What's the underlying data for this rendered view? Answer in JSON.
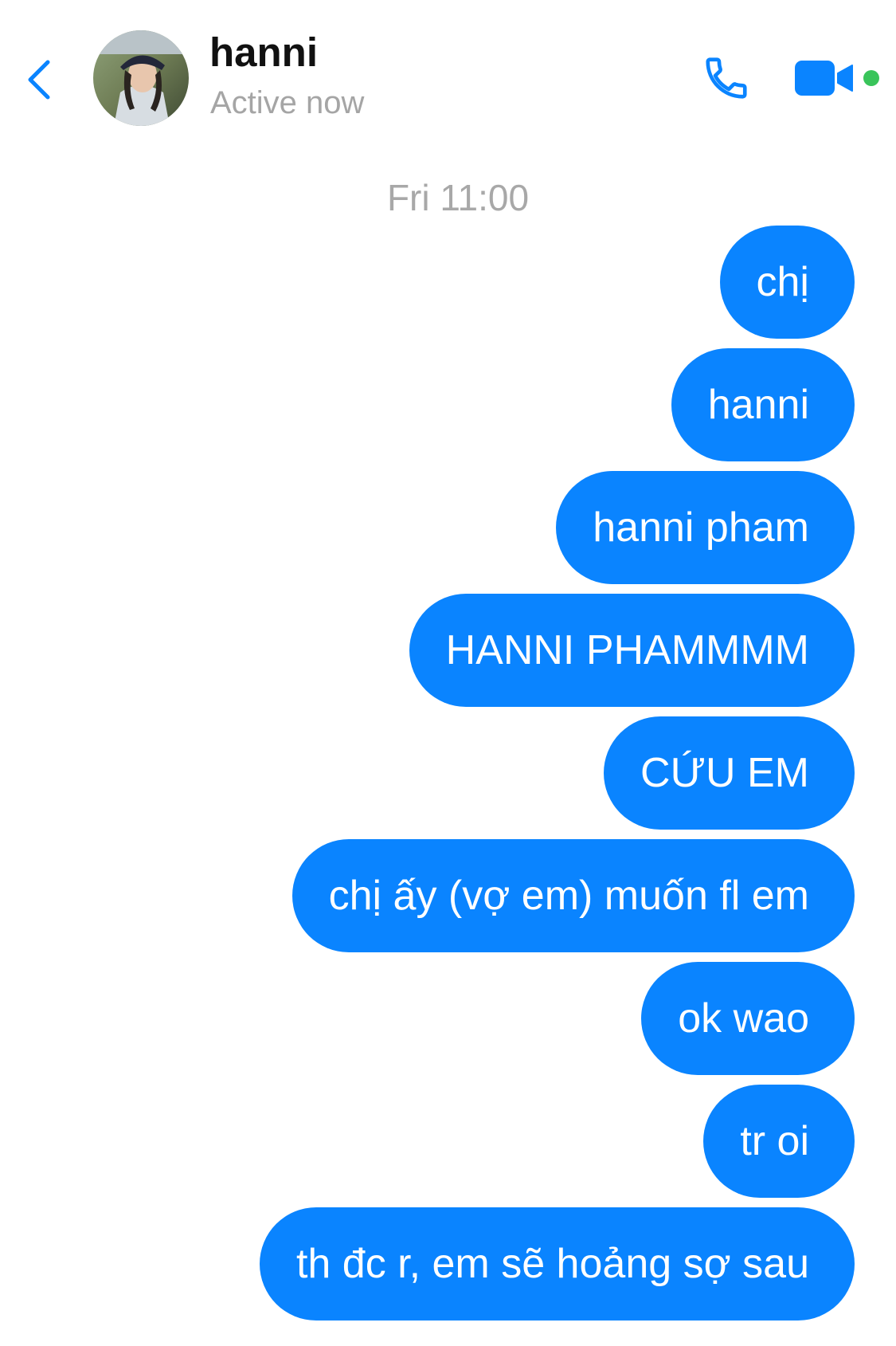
{
  "header": {
    "back_icon": "chevron-left-icon",
    "contact_name": "hanni",
    "status": "Active now",
    "call_icon": "phone-icon",
    "video_icon": "video-camera-icon",
    "online_indicator": "online-dot",
    "accent_color": "#0a84ff",
    "online_color": "#39c45a"
  },
  "conversation": {
    "timestamp": "Fri 11:00",
    "bubble_color": "#0a84ff",
    "messages": [
      {
        "text": "chị"
      },
      {
        "text": "hanni"
      },
      {
        "text": "hanni pham"
      },
      {
        "text": "HANNI PHAMMMM"
      },
      {
        "text": "CỨU EM"
      },
      {
        "text": "chị ấy (vợ em) muốn fl em"
      },
      {
        "text": "ok wao"
      },
      {
        "text": "tr oi"
      },
      {
        "text": "th đc r, em sẽ hoảng sợ sau"
      }
    ]
  }
}
